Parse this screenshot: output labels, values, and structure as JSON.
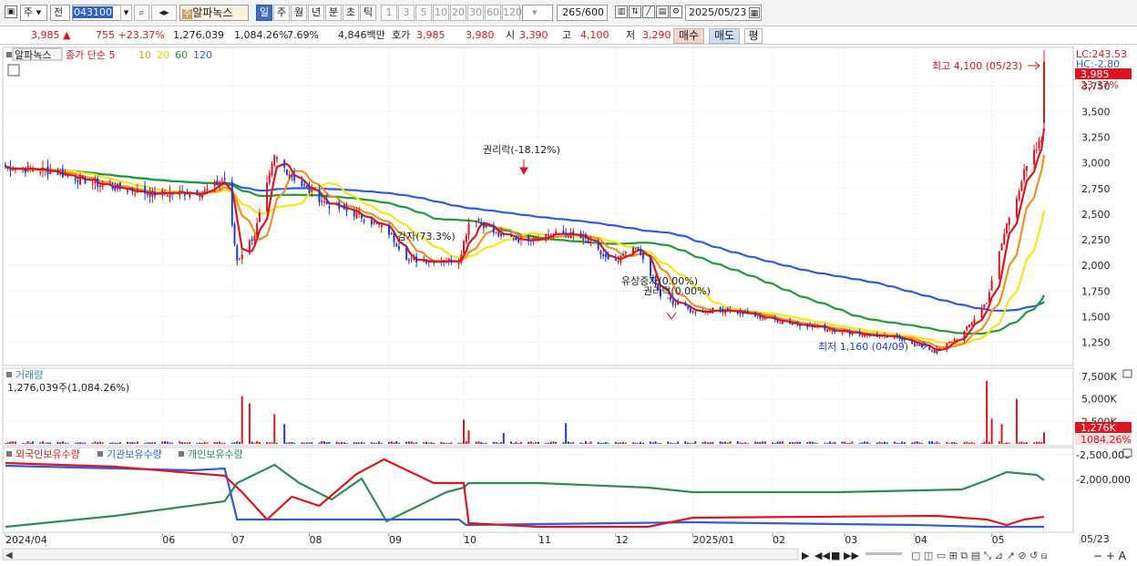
{
  "toolbar": {
    "market_select": "주",
    "mode_select": "전",
    "code": "043100",
    "stock_name": "알파녹스",
    "stock_badge": "주",
    "periods": [
      "일",
      "주",
      "월",
      "년",
      "분",
      "초",
      "틱"
    ],
    "active_period": "일",
    "minute_options": [
      "1",
      "3",
      "5",
      "10",
      "20",
      "30",
      "60",
      "120"
    ],
    "count": "265",
    "count_total": "/600",
    "date": "2025/05/23"
  },
  "quote": {
    "price": "3,985",
    "arrow": "▲",
    "change": "755",
    "change_pct": "+23.37%",
    "volume": "1,276,039",
    "volume_pct": "1,084.26%",
    "turnover": "7.69%",
    "amount": "4,846백만",
    "hoga_label": "호가",
    "ask": "3,985",
    "bid": "3,980",
    "open_label": "시",
    "open": "3,390",
    "high_label": "고",
    "high": "4,100",
    "low_label": "저",
    "low": "3,290",
    "buy_label": "매수",
    "sell_label": "매도",
    "eval_label": "평"
  },
  "colors": {
    "up": "#e0141e",
    "down": "#1a3fd1",
    "ma5": "#e0141e",
    "ma10": "#f29120",
    "ma20": "#f5e61a",
    "ma60": "#1f9a3a",
    "ma120": "#2f5be0",
    "foreign": "#e0141e",
    "institution": "#2f5be0",
    "individual": "#2e8b57"
  },
  "chart_data": [
    {
      "type": "candlestick",
      "title": "알파녹스",
      "legend": [
        "종가 단순 5",
        "10",
        "20",
        "60",
        "120"
      ],
      "legend_prefix": "종가 단순",
      "x_ticks": [
        "2024/04",
        "06",
        "07",
        "08",
        "09",
        "10",
        "11",
        "12",
        "2025/01",
        "02",
        "03",
        "04",
        "05"
      ],
      "last_date_label": "05/23",
      "y_ticks": [
        "3,750",
        "3,500",
        "3,250",
        "3,000",
        "2,750",
        "2,500",
        "2,250",
        "2,000",
        "1,750",
        "1,500",
        "1,250"
      ],
      "ylim": [
        1050,
        4100
      ],
      "close_tag": "3,985",
      "pct_tag": "23.37%",
      "lc_label": "LC:243.53",
      "hc_label": "HC:-2.80",
      "max_label": "최고 4,100 (05/23)",
      "min_label": "최저 1,160 (04/09)",
      "annotations": [
        "권리락(-18.12%)",
        "감자(73.3%)",
        "유상증자(0.00%)",
        "권리락(0.00%)"
      ],
      "price_path": [
        [
          "2024-04-01",
          2960
        ],
        [
          "2024-04-20",
          2920
        ],
        [
          "2024-05-10",
          2780
        ],
        [
          "2024-05-30",
          2700
        ],
        [
          "2024-06-20",
          2720
        ],
        [
          "2024-06-28",
          2840
        ],
        [
          "2024-07-03",
          2050
        ],
        [
          "2024-07-10",
          2300
        ],
        [
          "2024-07-18",
          3050
        ],
        [
          "2024-07-28",
          2800
        ],
        [
          "2024-08-08",
          2600
        ],
        [
          "2024-08-20",
          2500
        ],
        [
          "2024-09-01",
          2350
        ],
        [
          "2024-09-10",
          2050
        ],
        [
          "2024-09-30",
          2050
        ],
        [
          "2024-10-05",
          2500
        ],
        [
          "2024-10-15",
          2300
        ],
        [
          "2024-10-25",
          2250
        ],
        [
          "2024-11-05",
          2300
        ],
        [
          "2024-11-12",
          2310
        ],
        [
          "2024-11-20",
          2250
        ],
        [
          "2024-12-01",
          2000
        ],
        [
          "2024-12-10",
          2200
        ],
        [
          "2024-12-20",
          1700
        ],
        [
          "2025-01-02",
          1550
        ],
        [
          "2025-01-15",
          1570
        ],
        [
          "2025-02-01",
          1480
        ],
        [
          "2025-02-20",
          1400
        ],
        [
          "2025-03-10",
          1330
        ],
        [
          "2025-03-28",
          1280
        ],
        [
          "2025-04-09",
          1160
        ],
        [
          "2025-04-20",
          1320
        ],
        [
          "2025-04-30",
          1650
        ],
        [
          "2025-05-08",
          2400
        ],
        [
          "2025-05-15",
          2900
        ],
        [
          "2025-05-22",
          3230
        ],
        [
          "2025-05-23",
          3985
        ]
      ]
    },
    {
      "type": "bar",
      "title": "거래량",
      "subtitle": "1,276,039주(1,084.26%)",
      "y_ticks": [
        "7,500K",
        "5,000K",
        "2,500K"
      ],
      "ylim": [
        0,
        8000
      ],
      "last_tag": "1,276K",
      "last_pct": "1084.26%",
      "spikes_k": [
        [
          "2024-07-05",
          5300
        ],
        [
          "2024-07-08",
          4500
        ],
        [
          "2024-07-18",
          3300
        ],
        [
          "2024-07-22",
          2200
        ],
        [
          "2024-10-02",
          2700
        ],
        [
          "2024-10-04",
          1500
        ],
        [
          "2024-10-18",
          1200
        ],
        [
          "2024-11-12",
          2300
        ],
        [
          "2025-04-30",
          7000
        ],
        [
          "2025-05-02",
          2800
        ],
        [
          "2025-05-06",
          2200
        ],
        [
          "2025-05-12",
          5000
        ],
        [
          "2025-05-23",
          1276
        ]
      ]
    },
    {
      "type": "line",
      "series": [
        {
          "name": "외국인보유수량",
          "color": "#e0141e"
        },
        {
          "name": "기관보유수량",
          "color": "#2f5be0"
        },
        {
          "name": "개인보유수량",
          "color": "#2e8b57"
        }
      ],
      "y_ticks": [
        "-2,000,000",
        "-2,500,000"
      ]
    }
  ]
}
